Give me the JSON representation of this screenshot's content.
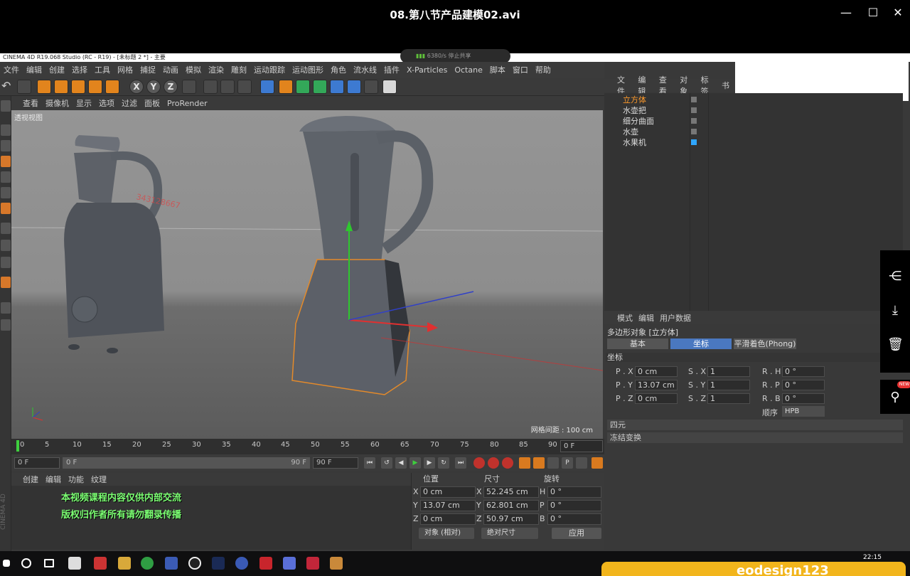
{
  "player": {
    "title": "08.第八节产品建模02.avi"
  },
  "c4d": {
    "window_title": "CINEMA 4D R19.068 Studio (RC - R19) - [未标题 2 *] - 主要",
    "rec_pill": "6380/s  停止共享",
    "menu": [
      "文件",
      "编辑",
      "创建",
      "选择",
      "工具",
      "网格",
      "捕捉",
      "动画",
      "模拟",
      "渲染",
      "雕刻",
      "运动跟踪",
      "运动图形",
      "角色",
      "流水线",
      "插件",
      "X-Particles",
      "Octane",
      "脚本",
      "窗口",
      "帮助"
    ],
    "toolbar_axis": [
      "X",
      "Y",
      "Z"
    ],
    "viewport_menu": [
      "查看",
      "摄像机",
      "显示",
      "选项",
      "过滤",
      "面板",
      "ProRender"
    ],
    "viewport_label": "透视视图",
    "watermark": "343128667",
    "grid_spacing": "网格间距 : 100 cm",
    "timeline_ticks": [
      "0",
      "5",
      "10",
      "15",
      "20",
      "25",
      "30",
      "35",
      "40",
      "45",
      "50",
      "55",
      "60",
      "65",
      "70",
      "75",
      "80",
      "85",
      "90"
    ],
    "current_frame": "0 F",
    "playbar": {
      "start": "0 F",
      "range_start": "0 F",
      "range_end": "90 F",
      "end": "90 F"
    },
    "material_menu": [
      "创建",
      "编辑",
      "功能",
      "纹理"
    ],
    "notice_line1": "本视频课程内容仅供内部交流",
    "notice_line2": "版权归作者所有请勿翻录传播",
    "side_label": "CINEMA 4D",
    "coords": {
      "headers": [
        "位置",
        "尺寸",
        "旋转"
      ],
      "rows": [
        {
          "axis": "X",
          "pos": "0 cm",
          "size_axis": "X",
          "size": "52.245 cm",
          "rot_axis": "H",
          "rot": "0 °"
        },
        {
          "axis": "Y",
          "pos": "13.07 cm",
          "size_axis": "Y",
          "size": "62.801 cm",
          "rot_axis": "P",
          "rot": "0 °"
        },
        {
          "axis": "Z",
          "pos": "0 cm",
          "size_axis": "Z",
          "size": "50.97 cm",
          "rot_axis": "B",
          "rot": "0 °"
        }
      ],
      "mode": "对象 (相对)",
      "size_mode": "绝对尺寸",
      "apply": "应用"
    },
    "object_manager": {
      "menu": [
        "文件",
        "编辑",
        "查看",
        "对象",
        "标签",
        "书"
      ],
      "objects": [
        {
          "name": "立方体",
          "selected": true
        },
        {
          "name": "水壶把",
          "selected": false
        },
        {
          "name": "细分曲面",
          "selected": false
        },
        {
          "name": "水壶",
          "selected": false
        },
        {
          "name": "水果机",
          "selected": false
        }
      ]
    },
    "attributes": {
      "menu": [
        "模式",
        "编辑",
        "用户数据"
      ],
      "title": "多边形对象 [立方体]",
      "tabs": [
        "基本",
        "坐标",
        "平滑着色(Phong)"
      ],
      "section": "坐标",
      "rows": [
        {
          "p_label": "P . X",
          "p": "0 cm",
          "s_label": "S . X",
          "s": "1",
          "r_label": "R . H",
          "r": "0 °"
        },
        {
          "p_label": "P . Y",
          "p": "13.07 cm",
          "s_label": "S . Y",
          "s": "1",
          "r_label": "R . P",
          "r": "0 °"
        },
        {
          "p_label": "P . Z",
          "p": "0 cm",
          "s_label": "S . Z",
          "s": "1",
          "r_label": "R . B",
          "r": "0 °"
        }
      ],
      "order_label": "顺序",
      "order_value": "HPB",
      "quaternion": "四元",
      "freeze": "冻结变换"
    }
  },
  "side_badge": "NEW",
  "taskbar": {
    "clock": "22:15"
  },
  "ad_text": "eodesign123"
}
